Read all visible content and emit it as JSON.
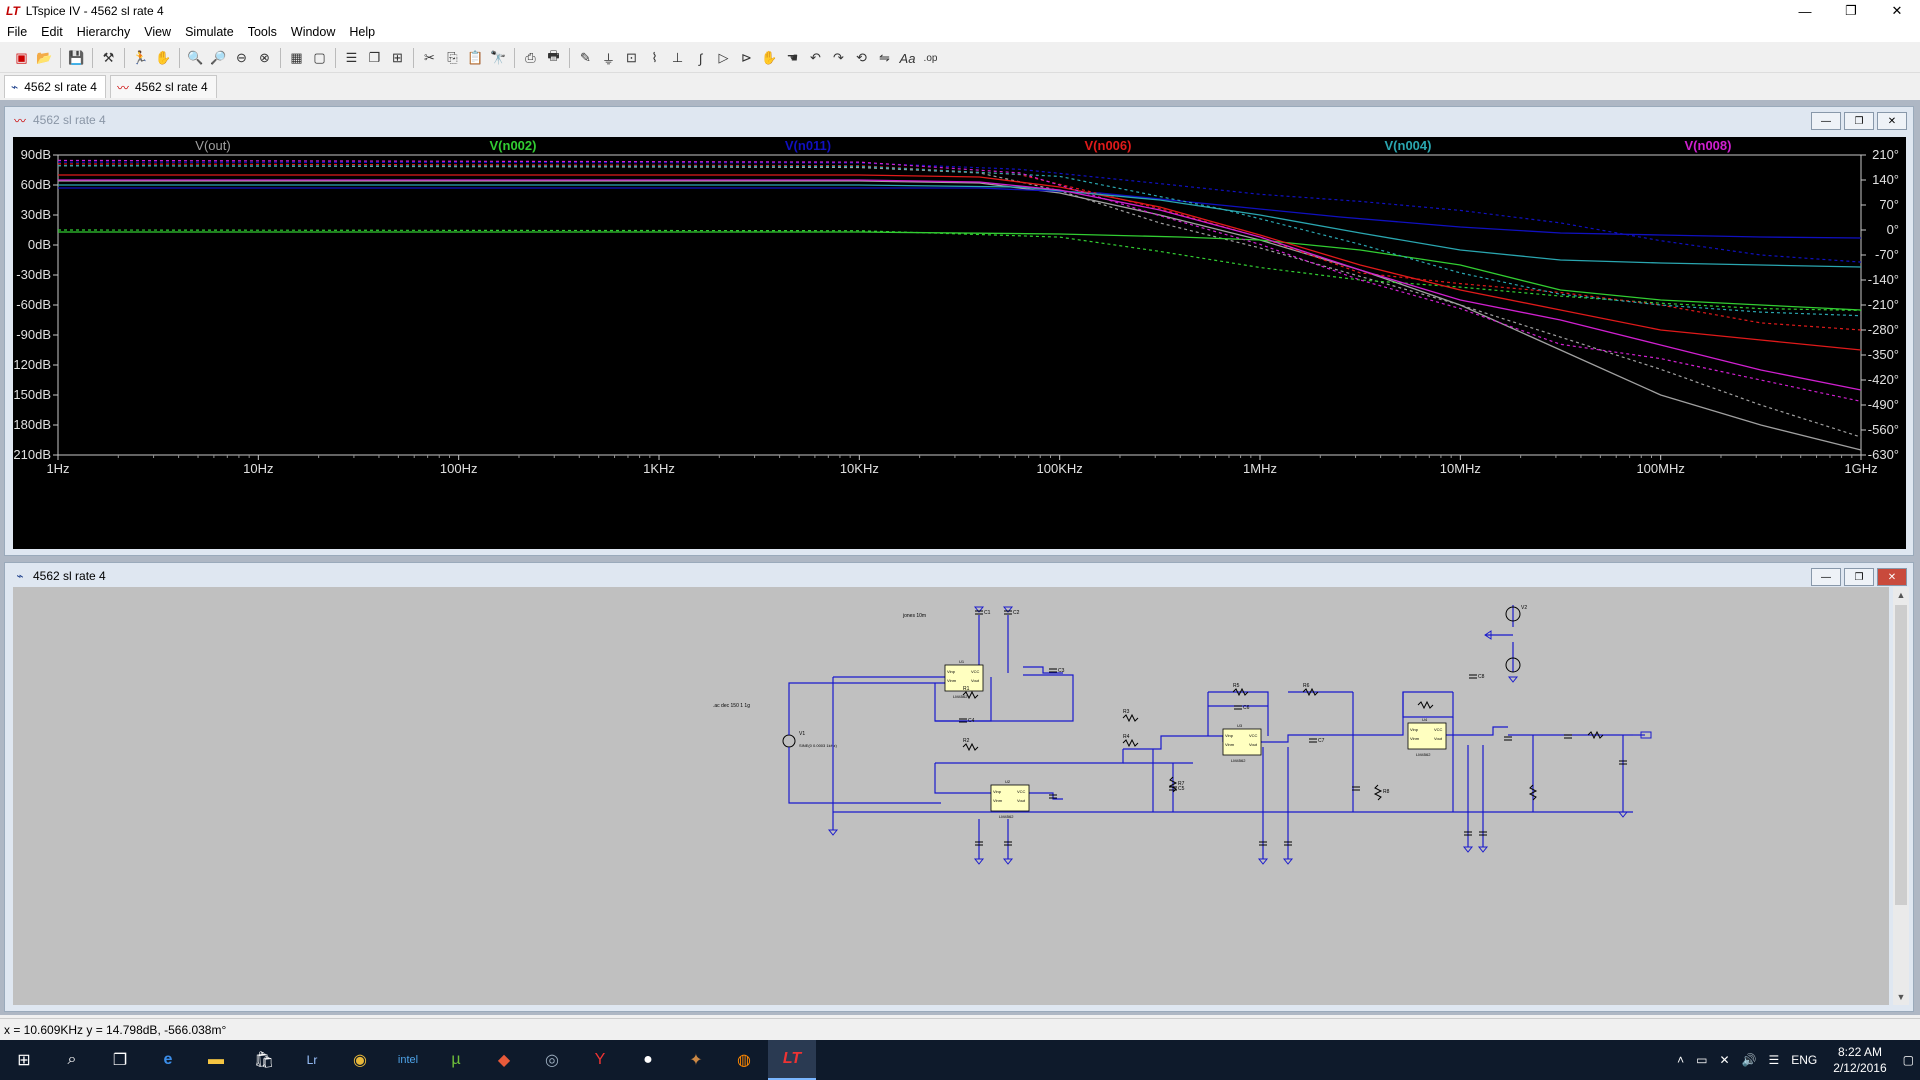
{
  "app": {
    "title": "LTspice IV - 4562  sl rate 4",
    "logo": "LT"
  },
  "window_controls": {
    "minimize": "—",
    "maximize": "❐",
    "close": "✕"
  },
  "menu": [
    "File",
    "Edit",
    "Hierarchy",
    "View",
    "Simulate",
    "Tools",
    "Window",
    "Help"
  ],
  "toolbar_icons": [
    "new-schematic",
    "open",
    "save",
    "control-panel",
    "run",
    "halt",
    "zoom-in",
    "zoom-pan",
    "zoom-out",
    "zoom-fit",
    "autorange",
    "view-grid",
    "cascade",
    "tile",
    "cut",
    "copy",
    "paste",
    "find",
    "print-preview",
    "print",
    "wire",
    "ground",
    "label-net",
    "resistor",
    "capacitor",
    "inductor",
    "diode",
    "component",
    "move",
    "drag",
    "undo",
    "redo",
    "rotate",
    "mirror",
    "text",
    "spice-directive"
  ],
  "tabs": [
    {
      "label": "4562  sl rate 4",
      "icon": "schematic-icon",
      "active": true
    },
    {
      "label": "4562  sl rate 4",
      "icon": "waveform-icon",
      "active": false
    }
  ],
  "plot_window": {
    "title": "4562  sl rate 4",
    "traces": [
      {
        "name": "V(out)",
        "color": "#a0a0a0"
      },
      {
        "name": "V(n002)",
        "color": "#32cd32"
      },
      {
        "name": "V(n011)",
        "color": "#1010c0"
      },
      {
        "name": "V(n006)",
        "color": "#e01a1a"
      },
      {
        "name": "V(n004)",
        "color": "#2aa6b0"
      },
      {
        "name": "V(n008)",
        "color": "#d020d0"
      }
    ]
  },
  "chart_data": {
    "type": "line",
    "title": "",
    "xlabel": "",
    "ylabel": "",
    "x_scale": "log",
    "x_ticks": [
      "1Hz",
      "10Hz",
      "100Hz",
      "1KHz",
      "10KHz",
      "100KHz",
      "1MHz",
      "10MHz",
      "100MHz",
      "1GHz"
    ],
    "y_ticks_left": [
      "90dB",
      "60dB",
      "30dB",
      "0dB",
      "-30dB",
      "-60dB",
      "-90dB",
      "-120dB",
      "-150dB",
      "-180dB",
      "-210dB"
    ],
    "y_ticks_right": [
      "210°",
      "140°",
      "70°",
      "0°",
      "-70°",
      "-140°",
      "-210°",
      "-280°",
      "-350°",
      "-420°",
      "-490°",
      "-560°",
      "-630°"
    ],
    "ylim_left": [
      -210,
      90
    ],
    "ylim_right": [
      -630,
      210
    ],
    "x_decades": [
      0,
      9
    ],
    "series": [
      {
        "name": "V(out)",
        "color": "#a0a0a0",
        "mag": [
          [
            0,
            64
          ],
          [
            4,
            64
          ],
          [
            4.6,
            62
          ],
          [
            5,
            52
          ],
          [
            5.5,
            30
          ],
          [
            6,
            5
          ],
          [
            6.5,
            -25
          ],
          [
            7,
            -60
          ],
          [
            7.5,
            -105
          ],
          [
            8,
            -150
          ],
          [
            8.5,
            -180
          ],
          [
            9,
            -205
          ]
        ],
        "phase": [
          [
            0,
            180
          ],
          [
            4,
            175
          ],
          [
            4.6,
            160
          ],
          [
            5,
            110
          ],
          [
            5.5,
            20
          ],
          [
            6,
            -50
          ],
          [
            6.5,
            -130
          ],
          [
            7,
            -210
          ],
          [
            7.5,
            -300
          ],
          [
            8,
            -390
          ],
          [
            8.5,
            -490
          ],
          [
            9,
            -580
          ]
        ]
      },
      {
        "name": "V(n002)",
        "color": "#32cd32",
        "mag": [
          [
            0,
            13
          ],
          [
            4,
            13
          ],
          [
            5,
            11
          ],
          [
            5.6,
            8
          ],
          [
            6,
            5
          ],
          [
            6.5,
            -5
          ],
          [
            7,
            -20
          ],
          [
            7.5,
            -45
          ],
          [
            8,
            -55
          ],
          [
            8.5,
            -60
          ],
          [
            9,
            -65
          ]
        ],
        "phase": [
          [
            0,
            0
          ],
          [
            4,
            -2
          ],
          [
            5,
            -20
          ],
          [
            5.5,
            -60
          ],
          [
            6,
            -105
          ],
          [
            6.5,
            -140
          ],
          [
            7,
            -160
          ],
          [
            7.5,
            -185
          ],
          [
            8,
            -205
          ],
          [
            8.5,
            -220
          ],
          [
            9,
            -225
          ]
        ]
      },
      {
        "name": "V(n011)",
        "color": "#1010c0",
        "mag": [
          [
            0,
            57
          ],
          [
            4,
            57
          ],
          [
            4.6,
            57
          ],
          [
            5.2,
            52
          ],
          [
            5.8,
            40
          ],
          [
            6.4,
            28
          ],
          [
            7,
            18
          ],
          [
            7.5,
            12
          ],
          [
            8,
            10
          ],
          [
            8.5,
            8
          ],
          [
            9,
            7
          ]
        ],
        "phase": [
          [
            0,
            190
          ],
          [
            4,
            188
          ],
          [
            4.8,
            170
          ],
          [
            5.5,
            130
          ],
          [
            6,
            100
          ],
          [
            6.5,
            80
          ],
          [
            7,
            55
          ],
          [
            7.5,
            20
          ],
          [
            8,
            -30
          ],
          [
            8.5,
            -70
          ],
          [
            9,
            -90
          ]
        ]
      },
      {
        "name": "V(n006)",
        "color": "#e01a1a",
        "mag": [
          [
            0,
            70
          ],
          [
            4,
            70
          ],
          [
            4.6,
            68
          ],
          [
            5,
            58
          ],
          [
            5.5,
            38
          ],
          [
            6,
            10
          ],
          [
            6.5,
            -20
          ],
          [
            7,
            -45
          ],
          [
            7.5,
            -65
          ],
          [
            8,
            -85
          ],
          [
            8.5,
            -95
          ],
          [
            9,
            -105
          ]
        ],
        "phase": [
          [
            0,
            185
          ],
          [
            4,
            180
          ],
          [
            4.8,
            155
          ],
          [
            5.5,
            60
          ],
          [
            6,
            -20
          ],
          [
            6.5,
            -120
          ],
          [
            7,
            -150
          ],
          [
            7.5,
            -175
          ],
          [
            8,
            -210
          ],
          [
            8.5,
            -260
          ],
          [
            9,
            -280
          ]
        ]
      },
      {
        "name": "V(n004)",
        "color": "#2aa6b0",
        "mag": [
          [
            0,
            60
          ],
          [
            4,
            60
          ],
          [
            4.8,
            58
          ],
          [
            5.5,
            45
          ],
          [
            6,
            30
          ],
          [
            6.5,
            12
          ],
          [
            7,
            -5
          ],
          [
            7.5,
            -15
          ],
          [
            8,
            -18
          ],
          [
            8.5,
            -20
          ],
          [
            9,
            -22
          ]
        ],
        "phase": [
          [
            0,
            180
          ],
          [
            4,
            178
          ],
          [
            5,
            150
          ],
          [
            5.8,
            60
          ],
          [
            6.5,
            -40
          ],
          [
            7,
            -120
          ],
          [
            7.5,
            -180
          ],
          [
            8,
            -210
          ],
          [
            8.5,
            -230
          ],
          [
            9,
            -240
          ]
        ]
      },
      {
        "name": "V(n008)",
        "color": "#d020d0",
        "mag": [
          [
            0,
            65
          ],
          [
            4,
            65
          ],
          [
            4.6,
            63
          ],
          [
            5,
            55
          ],
          [
            5.5,
            35
          ],
          [
            6,
            8
          ],
          [
            6.5,
            -25
          ],
          [
            7,
            -55
          ],
          [
            7.5,
            -75
          ],
          [
            8,
            -100
          ],
          [
            8.5,
            -125
          ],
          [
            9,
            -145
          ]
        ],
        "phase": [
          [
            0,
            195
          ],
          [
            4,
            190
          ],
          [
            4.8,
            160
          ],
          [
            5.5,
            40
          ],
          [
            6,
            -40
          ],
          [
            6.5,
            -140
          ],
          [
            7,
            -220
          ],
          [
            7.5,
            -320
          ],
          [
            8,
            -360
          ],
          [
            8.5,
            -420
          ],
          [
            9,
            -480
          ]
        ]
      }
    ]
  },
  "schematic_window": {
    "title": "4562  sl rate 4",
    "labels": {
      "directive_ac": ".ac dec 150 1 1g",
      "directive_param": "jones 10m",
      "source_val": "SINE(0 0.0003 1kHz)",
      "v1": "V1",
      "v2": "V2",
      "opamp": "LM4562",
      "u1": "U1",
      "u2": "U2",
      "u3": "U3",
      "u4": "U4",
      "r1": "R1",
      "r2": "R2",
      "r3": "R3",
      "r4": "R4",
      "r5": "R5",
      "r6": "R6",
      "r7": "R7",
      "r8": "R8",
      "c1": "C1",
      "c2": "C2",
      "c3": "C3",
      "c4": "C4",
      "c5": "C5",
      "c6": "C6",
      "c7": "C7",
      "c8": "C8"
    }
  },
  "status": {
    "cursor": "x = 10.609KHz    y = 14.798dB, -566.038m°"
  },
  "taskbar": {
    "apps": [
      "start",
      "search",
      "task-view",
      "edge",
      "explorer",
      "store",
      "lightroom",
      "chrome",
      "intel",
      "utorrent",
      "app-red",
      "app-blue",
      "app-y",
      "app-disc",
      "app-wolf",
      "app-orange",
      "ltspice"
    ],
    "tray_lang": "ENG",
    "time": "8:22 AM",
    "date": "2/12/2016"
  }
}
